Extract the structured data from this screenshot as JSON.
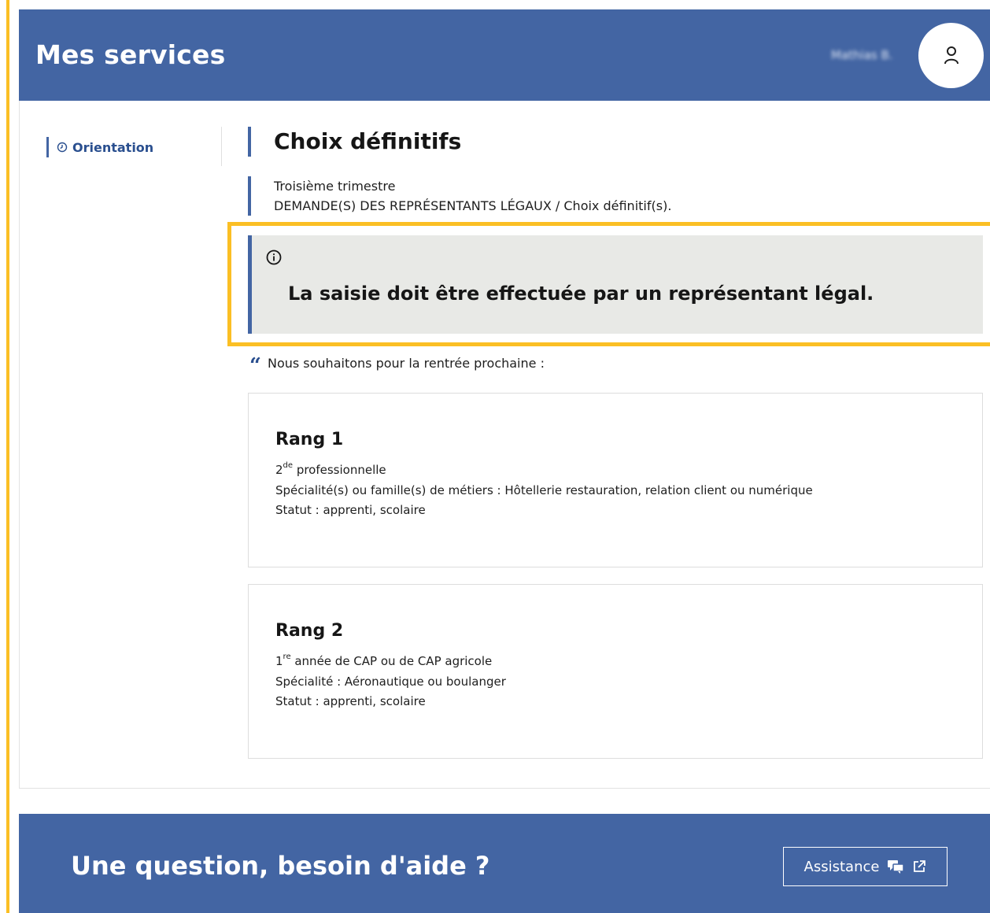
{
  "header": {
    "title": "Mes services",
    "user_name": "Mathias B."
  },
  "sidenav": {
    "items": [
      {
        "label": "Orientation",
        "active": true
      }
    ]
  },
  "page": {
    "title": "Choix définitifs",
    "subtitle_1": "Troisième trimestre",
    "subtitle_2": "DEMANDE(S) DES REPRÉSENTANTS LÉGAUX / Choix définitif(s).",
    "alert_text": "La saisie doit être effectuée par un représentant légal.",
    "quote_text": "Nous souhaitons pour la rentrée prochaine :"
  },
  "ranks": [
    {
      "title": "Rang 1",
      "level_number": "2",
      "level_sup": "de",
      "level_rest": " professionnelle",
      "speciality": "Spécialité(s) ou famille(s) de métiers : Hôtellerie restauration, relation client ou numérique",
      "status": "Statut : apprenti, scolaire"
    },
    {
      "title": "Rang 2",
      "level_number": "1",
      "level_sup": "re",
      "level_rest": " année de CAP ou de CAP agricole",
      "speciality": "Spécialité : Aéronautique ou boulanger",
      "status": "Statut : apprenti, scolaire"
    }
  ],
  "footer": {
    "title": "Une question, besoin d'aide ?",
    "assist_label": "Assistance"
  },
  "colors": {
    "brand_blue": "#4365a3",
    "highlight_yellow": "#fbbf24",
    "alert_bg": "#e8e9e6"
  }
}
